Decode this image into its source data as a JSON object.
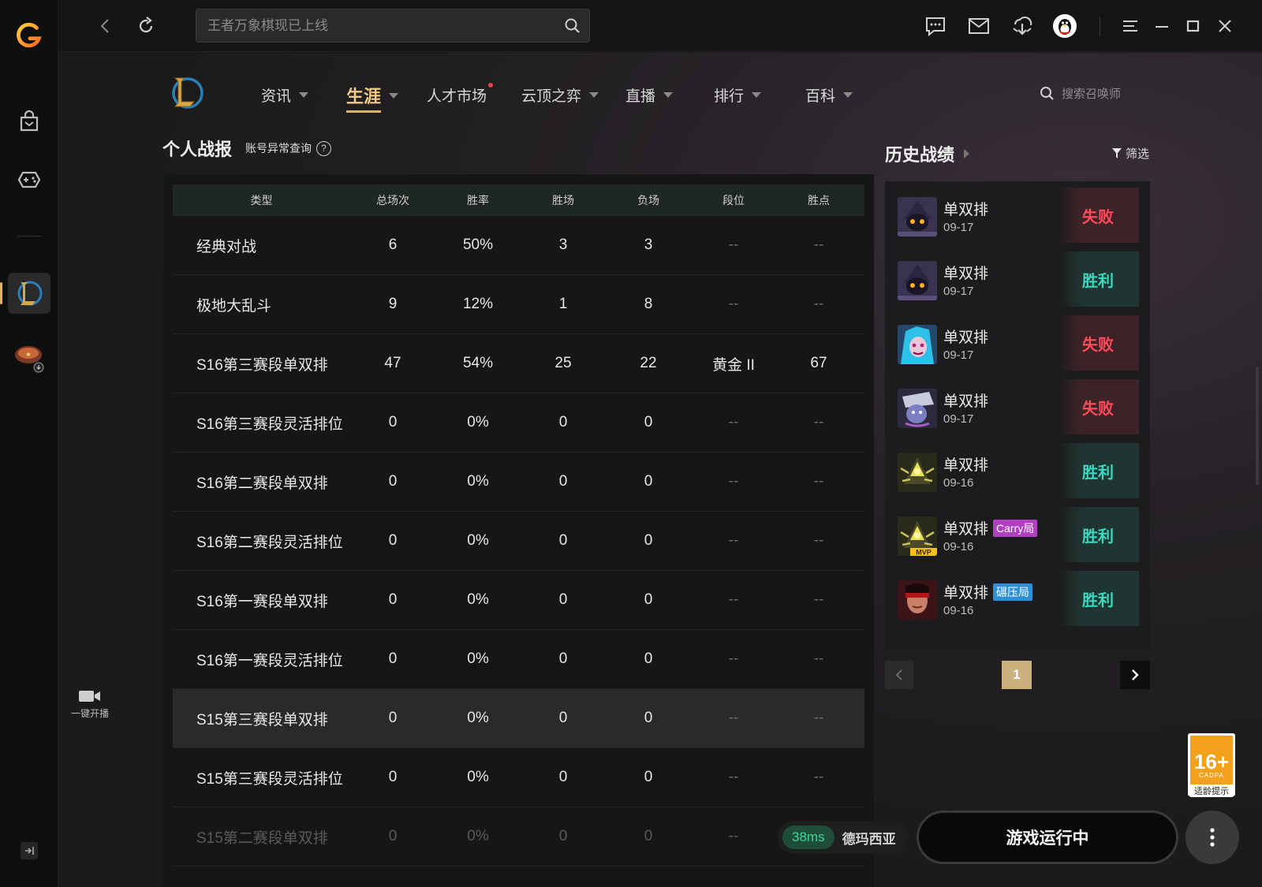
{
  "topbar": {
    "search_placeholder": "王者万象棋现已上线"
  },
  "game_nav": {
    "tabs": [
      {
        "label": "资讯",
        "caret": true
      },
      {
        "label": "生涯",
        "caret": true,
        "active": true
      },
      {
        "label": "人才市场",
        "dot": true
      },
      {
        "label": "云顶之弈",
        "caret": true
      },
      {
        "label": "直播",
        "caret": true
      },
      {
        "label": "排行",
        "caret": true
      },
      {
        "label": "百科",
        "caret": true
      }
    ],
    "summoner_search_placeholder": "搜索召唤师"
  },
  "stats": {
    "title": "个人战报",
    "account_check": "账号异常查询",
    "headers": [
      "类型",
      "总场次",
      "胜率",
      "胜场",
      "负场",
      "段位",
      "胜点"
    ],
    "rows": [
      [
        "经典对战",
        "6",
        "50%",
        "3",
        "3",
        "--",
        "--"
      ],
      [
        "极地大乱斗",
        "9",
        "12%",
        "1",
        "8",
        "--",
        "--"
      ],
      [
        "S16第三赛段单双排",
        "47",
        "54%",
        "25",
        "22",
        "黄金 II",
        "67"
      ],
      [
        "S16第三赛段灵活排位",
        "0",
        "0%",
        "0",
        "0",
        "--",
        "--"
      ],
      [
        "S16第二赛段单双排",
        "0",
        "0%",
        "0",
        "0",
        "--",
        "--"
      ],
      [
        "S16第二赛段灵活排位",
        "0",
        "0%",
        "0",
        "0",
        "--",
        "--"
      ],
      [
        "S16第一赛段单双排",
        "0",
        "0%",
        "0",
        "0",
        "--",
        "--"
      ],
      [
        "S16第一赛段灵活排位",
        "0",
        "0%",
        "0",
        "0",
        "--",
        "--"
      ],
      [
        "S15第三赛段单双排",
        "0",
        "0%",
        "0",
        "0",
        "--",
        "--"
      ],
      [
        "S15第三赛段灵活排位",
        "0",
        "0%",
        "0",
        "0",
        "--",
        "--"
      ],
      [
        "S15第二赛段单双排",
        "0",
        "0%",
        "0",
        "0",
        "--",
        "--"
      ]
    ]
  },
  "history": {
    "title": "历史战绩",
    "filter_label": "筛选",
    "matches": [
      {
        "mode": "单双排",
        "date": "09-17",
        "result": "失败",
        "outcome": "lose",
        "avatar": "veigar"
      },
      {
        "mode": "单双排",
        "date": "09-17",
        "result": "胜利",
        "outcome": "win",
        "avatar": "veigar"
      },
      {
        "mode": "单双排",
        "date": "09-17",
        "result": "失败",
        "outcome": "lose",
        "avatar": "jinx"
      },
      {
        "mode": "单双排",
        "date": "09-17",
        "result": "失败",
        "outcome": "lose",
        "avatar": "tristana"
      },
      {
        "mode": "单双排",
        "date": "09-16",
        "result": "胜利",
        "outcome": "win",
        "avatar": "xerath"
      },
      {
        "mode": "单双排",
        "date": "09-16",
        "result": "胜利",
        "outcome": "win",
        "avatar": "xerath",
        "tag": "Carry局",
        "tag_color": "#b03fc2",
        "mvp": "MVP"
      },
      {
        "mode": "单双排",
        "date": "09-16",
        "result": "胜利",
        "outcome": "win",
        "avatar": "lee-sin",
        "tag": "碾压局",
        "tag_color": "#2d8fd6"
      }
    ],
    "page": "1"
  },
  "bottom": {
    "record_label": "一键开播",
    "ping": "38ms",
    "server": "德玛西亚",
    "run_button": "游戏运行中",
    "age_rating": "16+",
    "age_org": "CADPA",
    "age_tip": "适龄提示"
  },
  "colors": {
    "accent": "#e0b468",
    "win": "#39d9c0",
    "lose": "#ff4a5a"
  }
}
